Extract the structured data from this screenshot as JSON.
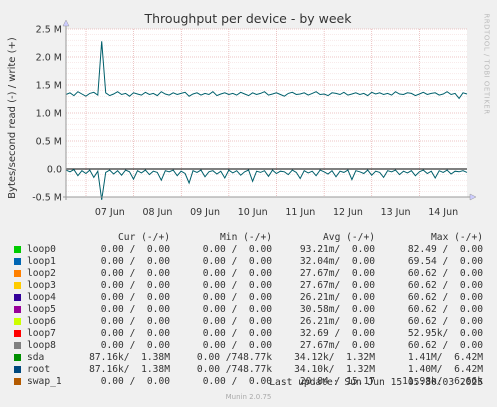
{
  "chart_data": {
    "type": "line",
    "title": "Throughput per device - by week",
    "ylabel": "Bytes/second read (-) / write (+)",
    "ylim": [
      -0.5,
      2.5
    ],
    "y_ticks": [
      "2.5 M",
      "2.0 M",
      "1.5 M",
      "1.0 M",
      "0.5 M",
      "0.0",
      "-0.5 M"
    ],
    "y_tick_values": [
      2.5,
      2.0,
      1.5,
      1.0,
      0.5,
      0.0,
      -0.5
    ],
    "x_ticks": [
      "07 Jun",
      "08 Jun",
      "09 Jun",
      "10 Jun",
      "11 Jun",
      "12 Jun",
      "13 Jun",
      "14 Jun"
    ],
    "grid": true,
    "series": [
      {
        "name": "root",
        "color": "#005f6b",
        "write_values": [
          1.33,
          1.36,
          1.31,
          1.38,
          1.34,
          1.3,
          1.35,
          1.37,
          1.32,
          2.28,
          1.36,
          1.31,
          1.34,
          1.38,
          1.33,
          1.35,
          1.3,
          1.36,
          1.34,
          1.32,
          1.37,
          1.33,
          1.35,
          1.31,
          1.38,
          1.34,
          1.32,
          1.36,
          1.33,
          1.35,
          1.37,
          1.3,
          1.34,
          1.36,
          1.32,
          1.35,
          1.33,
          1.38,
          1.31,
          1.34,
          1.36,
          1.33,
          1.35,
          1.32,
          1.37,
          1.34,
          1.31,
          1.36,
          1.33,
          1.35,
          1.38,
          1.32,
          1.34,
          1.36,
          1.33,
          1.3,
          1.35,
          1.37,
          1.33,
          1.34,
          1.36,
          1.32,
          1.35,
          1.38,
          1.33,
          1.34,
          1.31,
          1.36,
          1.35,
          1.33,
          1.37,
          1.32,
          1.34,
          1.36,
          1.33,
          1.35,
          1.31,
          1.37,
          1.34,
          1.36,
          1.33,
          1.35,
          1.32,
          1.38,
          1.34,
          1.33,
          1.36,
          1.35,
          1.31,
          1.34,
          1.37,
          1.33,
          1.35,
          1.36,
          1.32,
          1.34,
          1.38,
          1.33,
          1.35,
          1.26,
          1.36,
          1.34
        ],
        "read_values": [
          -0.02,
          -0.05,
          -0.01,
          -0.12,
          -0.03,
          -0.08,
          -0.02,
          -0.15,
          -0.04,
          -0.55,
          -0.06,
          -0.02,
          -0.09,
          -0.03,
          -0.11,
          -0.02,
          -0.05,
          -0.18,
          -0.03,
          -0.07,
          -0.02,
          -0.1,
          -0.04,
          -0.06,
          -0.2,
          -0.03,
          -0.05,
          -0.02,
          -0.12,
          -0.04,
          -0.08,
          -0.25,
          -0.03,
          -0.06,
          -0.02,
          -0.14,
          -0.05,
          -0.03,
          -0.09,
          -0.04,
          -0.16,
          -0.02,
          -0.07,
          -0.03,
          -0.11,
          -0.05,
          -0.02,
          -0.22,
          -0.04,
          -0.06,
          -0.03,
          -0.13,
          -0.02,
          -0.08,
          -0.04,
          -0.05,
          -0.1,
          -0.02,
          -0.06,
          -0.17,
          -0.03,
          -0.07,
          -0.04,
          -0.12,
          -0.02,
          -0.05,
          -0.09,
          -0.03,
          -0.14,
          -0.04,
          -0.06,
          -0.02,
          -0.19,
          -0.03,
          -0.05,
          -0.08,
          -0.02,
          -0.11,
          -0.04,
          -0.06,
          -0.15,
          -0.03,
          -0.05,
          -0.02,
          -0.1,
          -0.04,
          -0.07,
          -0.03,
          -0.12,
          -0.05,
          -0.02,
          -0.08,
          -0.04,
          -0.16,
          -0.03,
          -0.06,
          -0.02,
          -0.09,
          -0.04,
          -0.05,
          -0.03,
          -0.06
        ]
      }
    ]
  },
  "legend": {
    "headers": {
      "cur": "Cur (-/+)",
      "min": "Min (-/+)",
      "avg": "Avg (-/+)",
      "max": "Max (-/+)"
    },
    "rows": [
      {
        "name": "loop0",
        "color": "#00cc00",
        "cur": "0.00 /  0.00",
        "min": "0.00 /  0.00",
        "avg": "93.21m/  0.00",
        "max": "82.49 /  0.00"
      },
      {
        "name": "loop1",
        "color": "#0066b3",
        "cur": "0.00 /  0.00",
        "min": "0.00 /  0.00",
        "avg": "32.04m/  0.00",
        "max": "69.54 /  0.00"
      },
      {
        "name": "loop2",
        "color": "#ff8000",
        "cur": "0.00 /  0.00",
        "min": "0.00 /  0.00",
        "avg": "27.67m/  0.00",
        "max": "60.62 /  0.00"
      },
      {
        "name": "loop3",
        "color": "#ffcc00",
        "cur": "0.00 /  0.00",
        "min": "0.00 /  0.00",
        "avg": "27.67m/  0.00",
        "max": "60.62 /  0.00"
      },
      {
        "name": "loop4",
        "color": "#330099",
        "cur": "0.00 /  0.00",
        "min": "0.00 /  0.00",
        "avg": "26.21m/  0.00",
        "max": "60.62 /  0.00"
      },
      {
        "name": "loop5",
        "color": "#990099",
        "cur": "0.00 /  0.00",
        "min": "0.00 /  0.00",
        "avg": "30.58m/  0.00",
        "max": "60.62 /  0.00"
      },
      {
        "name": "loop6",
        "color": "#ccff00",
        "cur": "0.00 /  0.00",
        "min": "0.00 /  0.00",
        "avg": "26.21m/  0.00",
        "max": "60.62 /  0.00"
      },
      {
        "name": "loop7",
        "color": "#ff0000",
        "cur": "0.00 /  0.00",
        "min": "0.00 /  0.00",
        "avg": "32.69 /  0.00",
        "max": "52.95k/  0.00"
      },
      {
        "name": "loop8",
        "color": "#808080",
        "cur": "0.00 /  0.00",
        "min": "0.00 /  0.00",
        "avg": "27.67m/  0.00",
        "max": "60.62 /  0.00"
      },
      {
        "name": "sda",
        "color": "#008f00",
        "cur": "87.16k/  1.38M",
        "min": "0.00 /748.77k",
        "avg": "34.12k/  1.32M",
        "max": "1.41M/  6.42M"
      },
      {
        "name": "root",
        "color": "#00487d",
        "cur": "87.16k/  1.38M",
        "min": "0.00 /748.77k",
        "avg": "34.10k/  1.32M",
        "max": "1.40M/  6.42M"
      },
      {
        "name": "swap_1",
        "color": "#b35a00",
        "cur": "0.00 /  0.00",
        "min": "0.00 /  0.00",
        "avg": "20.84 / 15.17",
        "max": "11.98k/  6.66k"
      }
    ]
  },
  "last_update": "Last update: Sun Jun 15 05:30:03 2025",
  "footer": "Munin 2.0.75",
  "side_label": "RRDTOOL / TOBI OETIKER"
}
